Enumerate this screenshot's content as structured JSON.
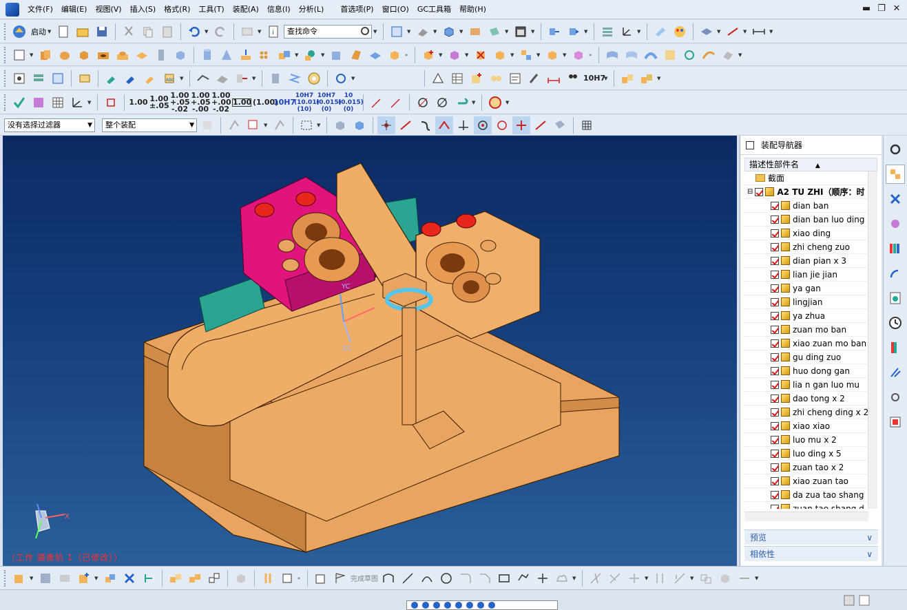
{
  "menubar": {
    "items": [
      "文件(F)",
      "编辑(E)",
      "视图(V)",
      "插入(S)",
      "格式(R)",
      "工具(T)",
      "装配(A)",
      "信息(I)",
      "分析(L)",
      "首选项(P)",
      "窗口(O)",
      "GC工具箱",
      "帮助(H)"
    ]
  },
  "toolbar": {
    "start_label": "启动",
    "search_placeholder": "查找命令",
    "dims": [
      "1.00",
      "1.00 ±.05",
      "1.00 +.05 -.02",
      "1.00 +.05 -.00",
      "1.00 +.00 -.02",
      "1.00",
      "(1.00)",
      "10H7",
      "10H7 (10.01) (10)",
      "10H7 (0.015) (0)",
      "10 (0.015) (0)"
    ],
    "dim_extra": "10H7"
  },
  "selection": {
    "filter": "没有选择过滤器",
    "scope": "整个装配"
  },
  "viewport": {
    "status": "（工作 摄像机 1（已修改））",
    "axis_labels": {
      "x": "X",
      "yc": "YC",
      "zc": "ZC"
    }
  },
  "navigator": {
    "title": "装配导航器",
    "column": "描述性部件名",
    "items": [
      {
        "label": "截面",
        "kind": "folder"
      },
      {
        "label": "A2 TU ZHI（顺序：时",
        "kind": "root"
      },
      {
        "label": "dian ban",
        "kind": "part"
      },
      {
        "label": "dian ban luo ding",
        "kind": "part"
      },
      {
        "label": "xiao  ding",
        "kind": "part"
      },
      {
        "label": "zhi cheng zuo",
        "kind": "part"
      },
      {
        "label": "dian  pian x 3",
        "kind": "part"
      },
      {
        "label": "lian jie jian",
        "kind": "part"
      },
      {
        "label": "ya gan",
        "kind": "part"
      },
      {
        "label": "lingjian",
        "kind": "part"
      },
      {
        "label": "ya zhua",
        "kind": "part"
      },
      {
        "label": "zuan mo ban",
        "kind": "part"
      },
      {
        "label": "xiao zuan mo ban",
        "kind": "part"
      },
      {
        "label": "gu ding zuo",
        "kind": "part"
      },
      {
        "label": "huo dong gan",
        "kind": "part"
      },
      {
        "label": "lia n  gan luo   mu",
        "kind": "part"
      },
      {
        "label": "dao tong x 2",
        "kind": "part"
      },
      {
        "label": "zhi cheng ding x 2",
        "kind": "part"
      },
      {
        "label": "xiao    xiao",
        "kind": "part"
      },
      {
        "label": "luo mu x 2",
        "kind": "part"
      },
      {
        "label": "luo ding x 5",
        "kind": "part"
      },
      {
        "label": "zuan  tao x 2",
        "kind": "part"
      },
      {
        "label": "xiao zuan tao",
        "kind": "part"
      },
      {
        "label": "da zua tao shang",
        "kind": "part"
      },
      {
        "label": "zuan tao shang d",
        "kind": "part"
      }
    ],
    "preview": "预览",
    "dependency": "相依性"
  },
  "bottom": {
    "finish_sketch": "完成草图"
  },
  "colors": {
    "accent": "#2c5fb3",
    "part_body": "#e8a460",
    "magenta_block": "#e0147a",
    "teal_part": "#2aa592",
    "screw_red": "#e8261e"
  }
}
